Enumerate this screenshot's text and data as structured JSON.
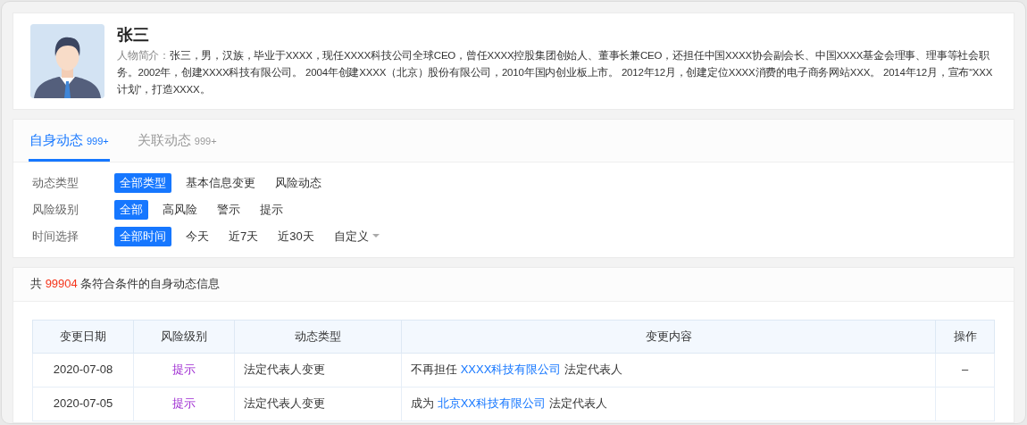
{
  "profile": {
    "name": "张三",
    "bio_label": "人物简介：",
    "bio": "张三，男，汉族，毕业于XXXX，现任XXXX科技公司全球CEO，曾任XXXX控股集团创始人、董事长兼CEO，还担任中国XXXX协会副会长、中国XXXX基金会理事、理事等社会职务。2002年，创建XXXX科技有限公司。 2004年创建XXXX（北京）股份有限公司，2010年国内创业板上市。 2012年12月，创建定位XXXX消费的电子商务网站XXX。 2014年12月，宣布“XXX计划”，打造XXXX。"
  },
  "tabs": [
    {
      "label": "自身动态",
      "count": "999+",
      "selected": true
    },
    {
      "label": "关联动态",
      "count": "999+",
      "selected": false
    }
  ],
  "filters": [
    {
      "label": "动态类型",
      "options": [
        {
          "label": "全部类型",
          "selected": true
        },
        {
          "label": "基本信息变更",
          "selected": false
        },
        {
          "label": "风险动态",
          "selected": false
        }
      ]
    },
    {
      "label": "风险级别",
      "options": [
        {
          "label": "全部",
          "selected": true
        },
        {
          "label": "高风险",
          "selected": false
        },
        {
          "label": "警示",
          "selected": false
        },
        {
          "label": "提示",
          "selected": false
        }
      ]
    },
    {
      "label": "时间选择",
      "options": [
        {
          "label": "全部时间",
          "selected": true
        },
        {
          "label": "今天",
          "selected": false
        },
        {
          "label": "近7天",
          "selected": false
        },
        {
          "label": "近30天",
          "selected": false
        },
        {
          "label": "自定义",
          "selected": false,
          "dropdown": true
        }
      ]
    }
  ],
  "summary": {
    "prefix": "共",
    "count": "99904",
    "suffix": "条符合条件的自身动态信息"
  },
  "table": {
    "columns": [
      "变更日期",
      "风险级别",
      "动态类型",
      "变更内容",
      "操作"
    ],
    "rows": [
      {
        "date": "2020-07-08",
        "risk": "提示",
        "type": "法定代表人变更",
        "content_before": "不再担任",
        "company": "XXXX科技有限公司",
        "content_after": "法定代表人",
        "action": "–"
      },
      {
        "date": "2020-07-05",
        "risk": "提示",
        "type": "法定代表人变更",
        "content_before": "成为",
        "company": "北京XX科技有限公司",
        "content_after": "法定代表人"
      }
    ]
  }
}
